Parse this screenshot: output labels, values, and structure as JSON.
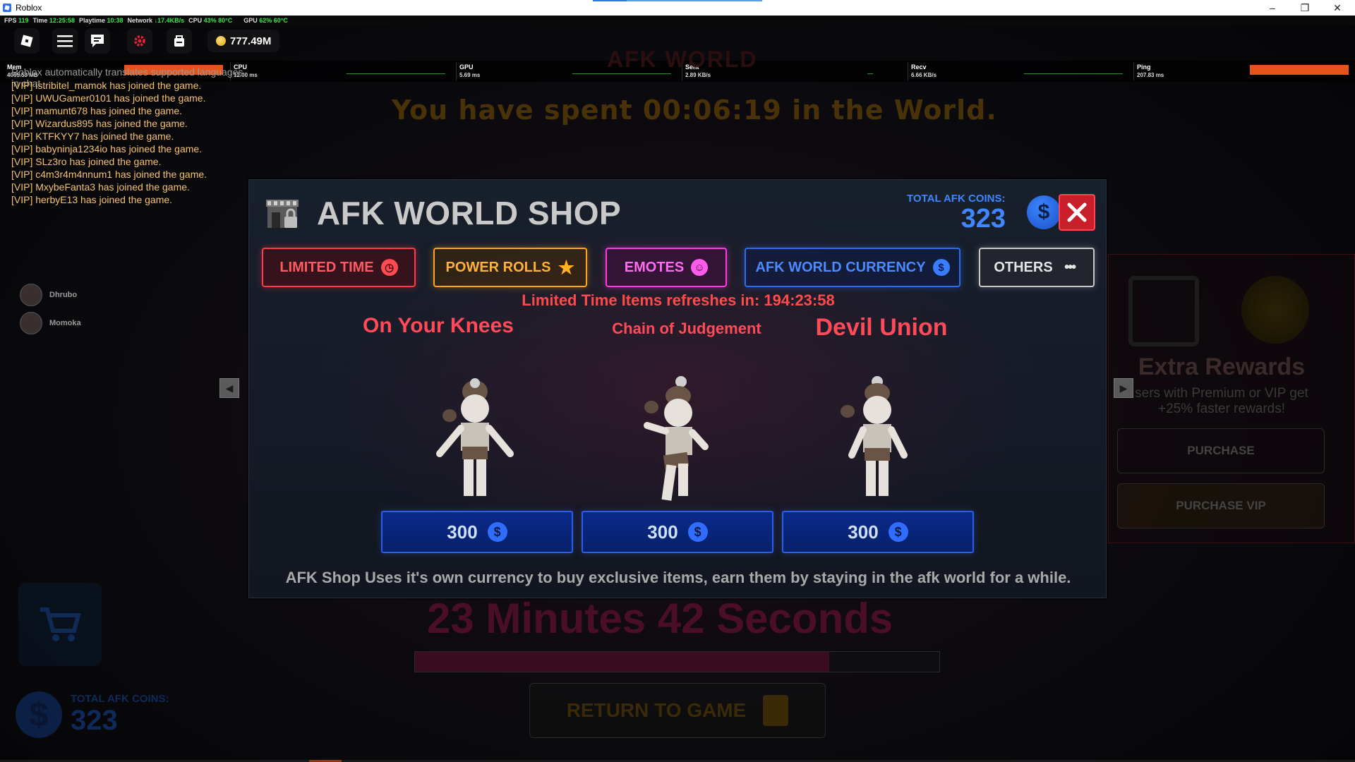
{
  "window": {
    "title": "Roblox",
    "controls": [
      "–",
      "❐",
      "✕"
    ]
  },
  "perf": [
    {
      "label": "FPS",
      "value": "119"
    },
    {
      "label": "Time",
      "value": "12:25:58"
    },
    {
      "label": "Playtime",
      "value": "10:38"
    },
    {
      "label": "Network",
      "value": "↓17.4KB/s"
    },
    {
      "label": "CPU",
      "value": "43%  80°C"
    },
    {
      "label": "GPU",
      "value": "62%  60°C"
    }
  ],
  "toolbar": {
    "coins": "777.49M"
  },
  "stats": [
    {
      "name": "Mem",
      "sub": "4065.53 MB"
    },
    {
      "name": "CPU",
      "sub": "12.00 ms"
    },
    {
      "name": "GPU",
      "sub": "5.69 ms"
    },
    {
      "name": "Sent",
      "sub": "2.89 KB/s"
    },
    {
      "name": "Recv",
      "sub": "6.66 KB/s"
    },
    {
      "name": "Ping",
      "sub": "207.83 ms"
    }
  ],
  "chat": {
    "system": "Roblox automatically translates supported languages in chat",
    "lines": [
      "[VIP] istribitel_mamok has joined the game.",
      "[VIP] UWUGamer0101 has joined the game.",
      "[VIP] mamunt678 has joined the game.",
      "[VIP] Wizardus895 has joined the game.",
      "[VIP] KTFKYY7 has joined the game.",
      "[VIP] babyninja1234io has joined the game.",
      "[VIP] SLz3ro has joined the game.",
      "[VIP] c4m3r4m4nnum1 has joined the game.",
      "[VIP] MxybeFanta3 has joined the game.",
      "[VIP] herbyE13 has joined the game."
    ]
  },
  "players": [
    "Dhrubo",
    "Momoka"
  ],
  "background": {
    "world_title": "AFK WORLD",
    "spent_text": "You have spent 00:06:19 in the World.",
    "minutes_text": "23 Minutes 42 Seconds",
    "progress": 0.79,
    "return_label": "RETURN TO GAME",
    "total_label": "TOTAL AFK COINS:",
    "total_value": "323",
    "rewards_title": "Extra Rewards",
    "rewards_desc_1": "sers with Premium or VIP get",
    "rewards_desc_2": "+25% faster rewards!",
    "purchase_label": "PURCHASE",
    "purchase_vip_label": "PURCHASE VIP"
  },
  "shop": {
    "title": "AFK WORLD SHOP",
    "total_label": "TOTAL AFK COINS:",
    "total_value": "323",
    "coin_symbol": "$",
    "tabs": [
      {
        "label": "LIMITED TIME"
      },
      {
        "label": "POWER ROLLS"
      },
      {
        "label": "EMOTES"
      },
      {
        "label": "AFK WORLD CURRENCY"
      },
      {
        "label": "OTHERS"
      }
    ],
    "refresh_text": "Limited Time Items refreshes in: 194:23:58",
    "items": [
      {
        "name": "On Your Knees",
        "price": "300"
      },
      {
        "name": "Chain of Judgement",
        "price": "300"
      },
      {
        "name": "Devil Union",
        "price": "300"
      }
    ],
    "footnote": "AFK Shop Uses it's own currency to buy exclusive items, earn them by staying in the afk world for a while."
  },
  "colors": {
    "accent_red": "#ff4a5a",
    "accent_blue": "#2f6cff",
    "accent_orange": "#ffa51e",
    "accent_pink": "#ff3be6"
  }
}
